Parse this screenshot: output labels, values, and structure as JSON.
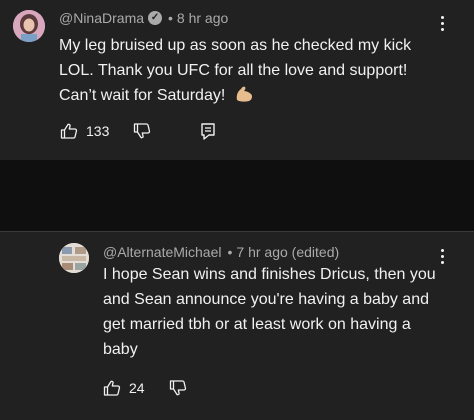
{
  "comments": [
    {
      "author": "@NinaDrama",
      "verified_icon": "verified-check-icon",
      "time": "8 hr ago",
      "text": "My leg bruised up as soon as he checked my kick LOL. Thank you UFC for all the love and support! Can’t wait for Saturday!",
      "emoji": "flexed-biceps-emoji",
      "likes": "133"
    },
    {
      "author": "@AlternateMichael",
      "time": "7 hr ago (edited)",
      "text": "I hope Sean wins and finishes Dricus, then you and Sean announce you're having a baby and get married tbh or at least work on having a baby",
      "likes": "24"
    }
  ],
  "separator": "•",
  "colors": {
    "background": "#0f0f0f",
    "card": "#212121",
    "meta_text": "#aaaaaa",
    "body_text": "#f1f1f1"
  }
}
